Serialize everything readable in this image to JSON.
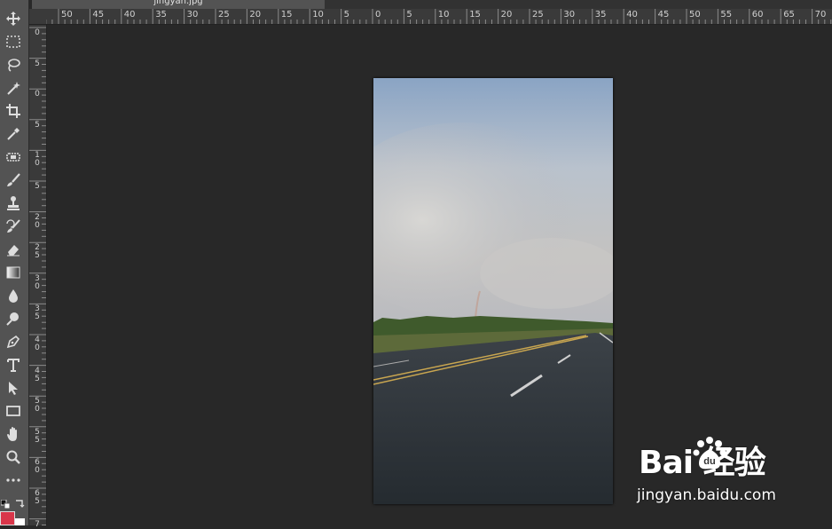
{
  "document_tab": {
    "title": "jingyan.jpg"
  },
  "rulers": {
    "top_labels": [
      "50",
      "45",
      "40",
      "35",
      "30",
      "25",
      "20",
      "15",
      "10",
      "5",
      "0",
      "5",
      "10",
      "15",
      "20",
      "25",
      "30",
      "35",
      "40",
      "45",
      "50",
      "55",
      "60",
      "65",
      "70"
    ],
    "left_labels": [
      "0",
      "5",
      "0",
      "5",
      "10",
      "5",
      "20",
      "25",
      "30",
      "35",
      "40",
      "45",
      "50",
      "55",
      "60",
      "65",
      "7"
    ]
  },
  "toolbar": {
    "tools": [
      {
        "name": "move-tool",
        "icon": "move-icon"
      },
      {
        "name": "rectangular-marquee-tool",
        "icon": "marquee-icon"
      },
      {
        "name": "lasso-tool",
        "icon": "lasso-icon"
      },
      {
        "name": "magic-wand-tool",
        "icon": "magic-wand-icon"
      },
      {
        "name": "crop-tool",
        "icon": "crop-icon"
      },
      {
        "name": "eyedropper-tool",
        "icon": "eyedropper-icon"
      },
      {
        "name": "spot-healing-tool",
        "icon": "bandage-icon"
      },
      {
        "name": "brush-tool",
        "icon": "brush-icon"
      },
      {
        "name": "clone-stamp-tool",
        "icon": "stamp-icon"
      },
      {
        "name": "history-brush-tool",
        "icon": "history-brush-icon"
      },
      {
        "name": "eraser-tool",
        "icon": "eraser-icon"
      },
      {
        "name": "gradient-tool",
        "icon": "gradient-icon"
      },
      {
        "name": "blur-tool",
        "icon": "drop-icon"
      },
      {
        "name": "dodge-tool",
        "icon": "dodge-icon"
      },
      {
        "name": "pen-tool",
        "icon": "pen-icon"
      },
      {
        "name": "type-tool",
        "icon": "type-icon"
      },
      {
        "name": "path-selection-tool",
        "icon": "arrow-icon"
      },
      {
        "name": "rectangle-tool",
        "icon": "rectangle-icon"
      },
      {
        "name": "hand-tool",
        "icon": "hand-icon"
      },
      {
        "name": "zoom-tool",
        "icon": "zoom-icon"
      },
      {
        "name": "more-tools",
        "icon": "ellipsis-icon"
      }
    ],
    "foreground_color": "#d9364a",
    "background_color": "#ffffff"
  },
  "watermark": {
    "logo_text": "Bai  经验",
    "url": "jingyan.baidu.com"
  }
}
